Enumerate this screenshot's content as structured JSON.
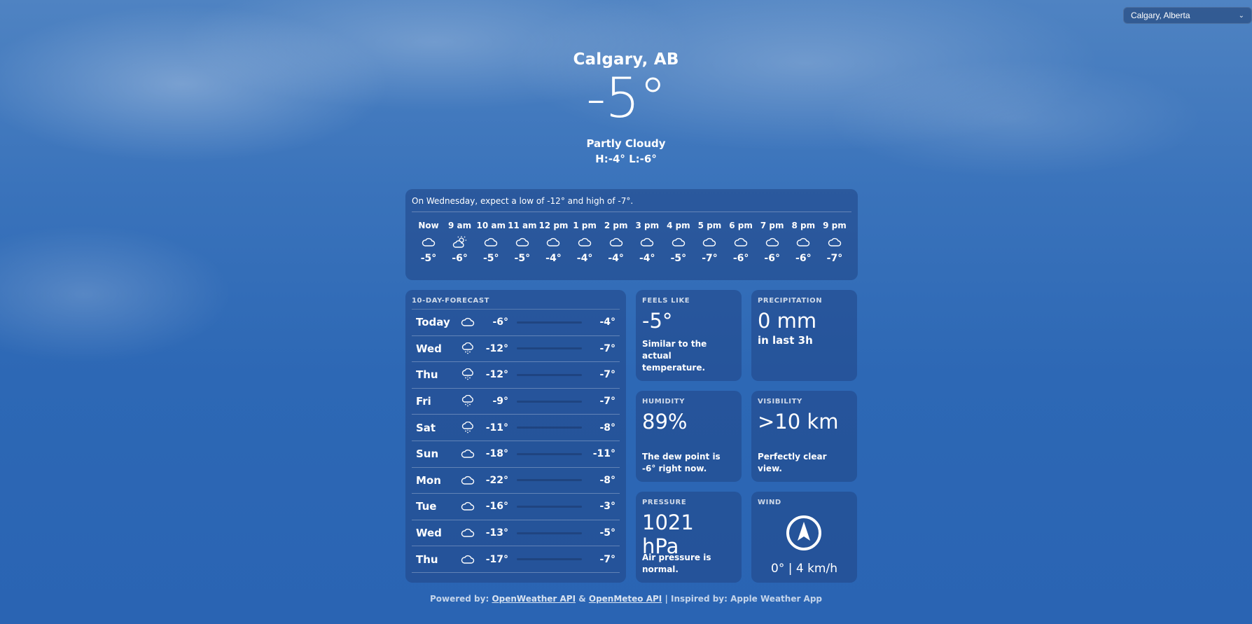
{
  "location_select": {
    "value": "Calgary, Alberta"
  },
  "current": {
    "city": "Calgary, AB",
    "temp": "-5°",
    "condition": "Partly Cloudy",
    "hilo": "H:-4° L:-6°"
  },
  "hourly": {
    "summary": "On Wednesday, expect a low of -12° and high of -7°.",
    "hours": [
      {
        "label": "Now",
        "icon": "cloud-icon",
        "temp": "-5°"
      },
      {
        "label": "9 am",
        "icon": "sun-cloud-icon",
        "temp": "-6°"
      },
      {
        "label": "10 am",
        "icon": "cloud-icon",
        "temp": "-5°"
      },
      {
        "label": "11 am",
        "icon": "cloud-icon",
        "temp": "-5°"
      },
      {
        "label": "12 pm",
        "icon": "cloud-icon",
        "temp": "-4°"
      },
      {
        "label": "1 pm",
        "icon": "cloud-icon",
        "temp": "-4°"
      },
      {
        "label": "2 pm",
        "icon": "cloud-icon",
        "temp": "-4°"
      },
      {
        "label": "3 pm",
        "icon": "cloud-icon",
        "temp": "-4°"
      },
      {
        "label": "4 pm",
        "icon": "cloud-icon",
        "temp": "-5°"
      },
      {
        "label": "5 pm",
        "icon": "cloud-icon",
        "temp": "-7°"
      },
      {
        "label": "6 pm",
        "icon": "cloud-icon",
        "temp": "-6°"
      },
      {
        "label": "7 pm",
        "icon": "cloud-icon",
        "temp": "-6°"
      },
      {
        "label": "8 pm",
        "icon": "cloud-icon",
        "temp": "-6°"
      },
      {
        "label": "9 pm",
        "icon": "cloud-icon",
        "temp": "-7°"
      }
    ]
  },
  "tenday": {
    "title": "10-DAY-FORECAST",
    "days": [
      {
        "day": "Today",
        "icon": "cloud-icon",
        "low": "-6°",
        "high": "-4°"
      },
      {
        "day": "Wed",
        "icon": "snow-cloud-icon",
        "low": "-12°",
        "high": "-7°"
      },
      {
        "day": "Thu",
        "icon": "snow-cloud-icon",
        "low": "-12°",
        "high": "-7°"
      },
      {
        "day": "Fri",
        "icon": "snow-cloud-icon",
        "low": "-9°",
        "high": "-7°"
      },
      {
        "day": "Sat",
        "icon": "snow-cloud-icon",
        "low": "-11°",
        "high": "-8°"
      },
      {
        "day": "Sun",
        "icon": "cloud-icon",
        "low": "-18°",
        "high": "-11°"
      },
      {
        "day": "Mon",
        "icon": "cloud-icon",
        "low": "-22°",
        "high": "-8°"
      },
      {
        "day": "Tue",
        "icon": "cloud-icon",
        "low": "-16°",
        "high": "-3°"
      },
      {
        "day": "Wed",
        "icon": "cloud-icon",
        "low": "-13°",
        "high": "-5°"
      },
      {
        "day": "Thu",
        "icon": "cloud-icon",
        "low": "-17°",
        "high": "-7°"
      }
    ]
  },
  "feels_like": {
    "title": "FEELS LIKE",
    "value": "-5°",
    "desc": "Similar to the actual temperature."
  },
  "precipitation": {
    "title": "PRECIPITATION",
    "value": "0 mm",
    "sub": "in last 3h"
  },
  "humidity": {
    "title": "HUMIDITY",
    "value": "89%",
    "desc": "The dew point is -6° right now."
  },
  "visibility": {
    "title": "VISIBILITY",
    "value": ">10 km",
    "desc": "Perfectly clear view."
  },
  "pressure": {
    "title": "PRESSURE",
    "value": "1021 hPa",
    "desc": "Air pressure is normal."
  },
  "wind": {
    "title": "WIND",
    "value": "0° | 4 km/h"
  },
  "footer": {
    "prefix": "Powered by:",
    "link1": "OpenWeather API",
    "amp": "&",
    "link2": "OpenMeteo API",
    "suffix": "| Inspired by: Apple Weather App"
  }
}
